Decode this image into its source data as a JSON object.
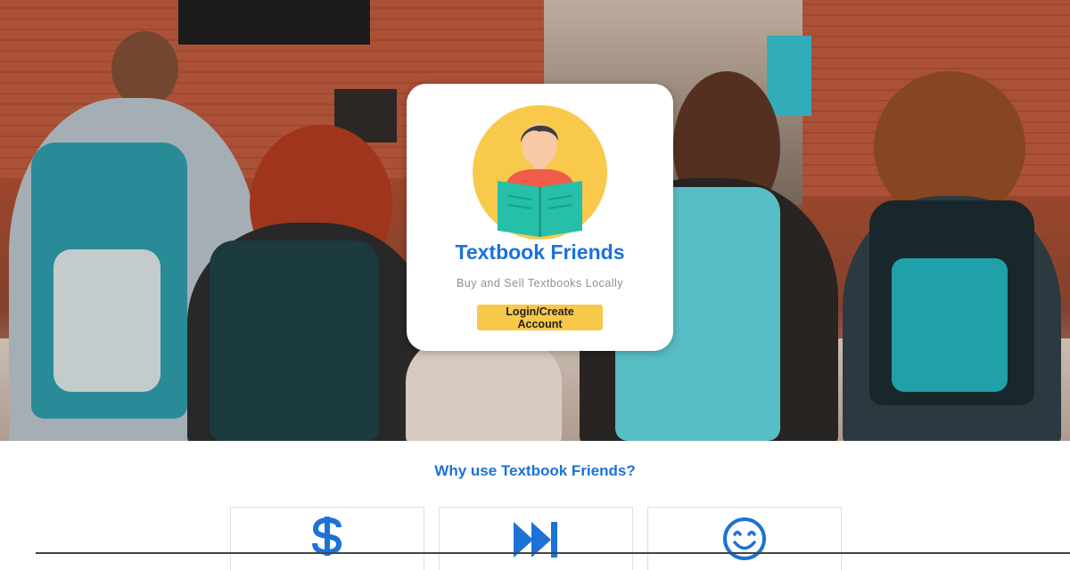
{
  "card": {
    "title": "Textbook Friends",
    "tagline": "Buy and Sell Textbooks Locally",
    "login_button": "Login/Create Account",
    "logo_icon": "reader-with-book-icon"
  },
  "why_section": {
    "heading": "Why use Textbook Friends?",
    "features": [
      {
        "icon": "dollar-icon"
      },
      {
        "icon": "fast-forward-icon"
      },
      {
        "icon": "smiley-icon"
      }
    ]
  },
  "colors": {
    "brand_blue": "#1c72d6",
    "button_yellow": "#f8c84a",
    "logo_circle": "#f9c94b",
    "book_teal": "#26c0a8"
  }
}
